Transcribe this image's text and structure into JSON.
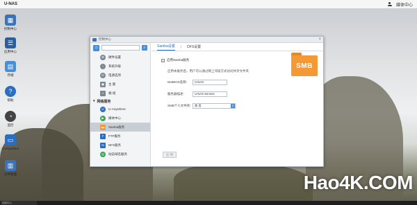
{
  "topbar": {
    "brand": "U-NAS",
    "user_label": "媒体中心"
  },
  "desktop": [
    {
      "label": "控制中心",
      "icon": "control-center-icon",
      "color": "#3a73b8"
    },
    {
      "label": "应用中心",
      "icon": "app-center-icon",
      "color": "#2d5d9c"
    },
    {
      "label": "存储",
      "icon": "storage-icon",
      "color": "#4a8fd6"
    },
    {
      "label": "帮助",
      "icon": "help-icon",
      "color": "#2a6ebf"
    },
    {
      "label": "监控",
      "icon": "monitor-icon",
      "color": "#444444"
    },
    {
      "label": "U-Anywhere",
      "icon": "u-anywhere-icon",
      "color": "#2a6ebf"
    },
    {
      "label": "文件管理",
      "icon": "file-manager-icon",
      "color": "#3a73b8"
    }
  ],
  "window": {
    "title": "控制中心",
    "search_placeholder": "",
    "sidebar": {
      "items_top": [
        {
          "label": "硬件设置",
          "icon": "hardware-icon",
          "color": "#7c8894"
        },
        {
          "label": "系统升级",
          "icon": "upgrade-icon",
          "color": "#7c8894"
        },
        {
          "label": "电源选项",
          "icon": "power-icon",
          "color": "#7c8894"
        },
        {
          "label": "主 题",
          "icon": "theme-icon",
          "color": "#7c8894"
        },
        {
          "label": "端 组",
          "icon": "group-icon",
          "color": "#7c8894"
        }
      ],
      "group_label": "网络服务",
      "items_net": [
        {
          "label": "U-Anywhere",
          "icon": "u-anywhere-icon",
          "color": "#2a6ebf"
        },
        {
          "label": "媒体中心",
          "icon": "media-center-icon",
          "color": "#3aa55a"
        },
        {
          "label": "Samba服务",
          "icon": "samba-icon",
          "color": "#f39a36"
        },
        {
          "label": "FTP服务",
          "icon": "ftp-icon",
          "color": "#2a6ebf"
        },
        {
          "label": "NFS服务",
          "icon": "nfs-icon",
          "color": "#2a6ebf"
        },
        {
          "label": "动态域名服务",
          "icon": "ddns-icon",
          "color": "#3aa55a"
        }
      ]
    },
    "tabs": [
      "Samba设置",
      "DFS设置"
    ],
    "form": {
      "enable_label": "启用Samba服务",
      "description": "启用本服务后，用户可以通过网上邻居方式访问共享文件夹",
      "netbios_label": "NetBIOS名称:",
      "netbios_value": "U-NAS",
      "server_desc_label": "服务器描述:",
      "server_desc_value": "U-NAS Servers",
      "personal_folder_label": "SMB个人文件夹:",
      "personal_folder_value": "禁 用",
      "apply_label": "应 用"
    },
    "smb_badge": "SMB"
  },
  "taskbar": {
    "item": "控制中心"
  },
  "watermark": "Hao4K.COM"
}
